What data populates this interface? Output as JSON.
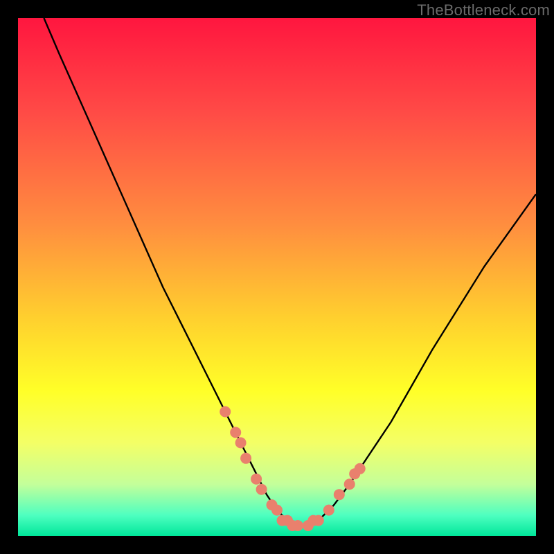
{
  "watermark": "TheBottleneck.com",
  "chart_data": {
    "type": "line",
    "title": "",
    "xlabel": "",
    "ylabel": "",
    "xlim": [
      0,
      100
    ],
    "ylim": [
      0,
      100
    ],
    "gradient_stops": [
      {
        "offset": 0.0,
        "color": "#ff163f"
      },
      {
        "offset": 0.18,
        "color": "#ff4a46"
      },
      {
        "offset": 0.4,
        "color": "#ff8e3f"
      },
      {
        "offset": 0.58,
        "color": "#ffd02e"
      },
      {
        "offset": 0.72,
        "color": "#ffff28"
      },
      {
        "offset": 0.82,
        "color": "#f4ff66"
      },
      {
        "offset": 0.9,
        "color": "#c4ff9a"
      },
      {
        "offset": 0.96,
        "color": "#4effc0"
      },
      {
        "offset": 1.0,
        "color": "#00e69a"
      }
    ],
    "series": [
      {
        "name": "bottleneck-curve",
        "color": "#000000",
        "x": [
          5,
          8,
          12,
          16,
          20,
          24,
          28,
          32,
          36,
          40,
          43,
          46,
          48,
          50,
          52,
          54,
          56,
          58,
          61,
          64,
          68,
          72,
          76,
          80,
          85,
          90,
          95,
          100
        ],
        "y": [
          100,
          93,
          84,
          75,
          66,
          57,
          48,
          40,
          32,
          24,
          18,
          12,
          8,
          5,
          3,
          2,
          2,
          3,
          6,
          10,
          16,
          22,
          29,
          36,
          44,
          52,
          59,
          66
        ]
      }
    ],
    "markers": {
      "name": "highlighted-points",
      "color": "#e9806d",
      "points": [
        {
          "x": 40,
          "y": 24
        },
        {
          "x": 42,
          "y": 20
        },
        {
          "x": 43,
          "y": 18
        },
        {
          "x": 44,
          "y": 15
        },
        {
          "x": 46,
          "y": 11
        },
        {
          "x": 47,
          "y": 9
        },
        {
          "x": 49,
          "y": 6
        },
        {
          "x": 50,
          "y": 5
        },
        {
          "x": 51,
          "y": 3
        },
        {
          "x": 52,
          "y": 3
        },
        {
          "x": 53,
          "y": 2
        },
        {
          "x": 54,
          "y": 2
        },
        {
          "x": 56,
          "y": 2
        },
        {
          "x": 57,
          "y": 3
        },
        {
          "x": 58,
          "y": 3
        },
        {
          "x": 60,
          "y": 5
        },
        {
          "x": 62,
          "y": 8
        },
        {
          "x": 64,
          "y": 10
        },
        {
          "x": 65,
          "y": 12
        },
        {
          "x": 66,
          "y": 13
        }
      ]
    }
  }
}
